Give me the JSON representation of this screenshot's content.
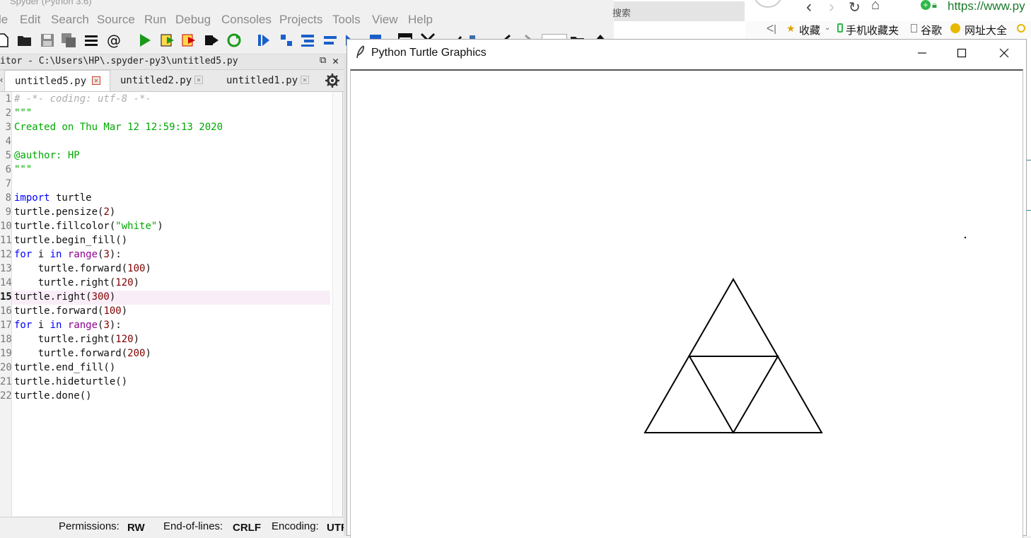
{
  "spyder": {
    "title_partial": "Spyder (Python 3.6)",
    "menu": [
      "le",
      "Edit",
      "Search",
      "Source",
      "Run",
      "Debug",
      "Consoles",
      "Projects",
      "Tools",
      "View",
      "Help"
    ],
    "editor_title": "itor - C:\\Users\\HP\\.spyder-py3\\untitled5.py",
    "tabs": [
      {
        "label": "untitled5.py",
        "active": true
      },
      {
        "label": "untitled2.py",
        "active": false
      },
      {
        "label": "untitled1.py",
        "active": false
      }
    ],
    "current_line": 15,
    "lines": [
      "# -*- coding: utf-8 -*-",
      "\"\"\"",
      "Created on Thu Mar 12 12:59:13 2020",
      "",
      "@author: HP",
      "\"\"\"",
      "",
      "import turtle",
      "turtle.pensize(2)",
      "turtle.fillcolor(\"white\")",
      "turtle.begin_fill()",
      "for i in range(3):",
      "    turtle.forward(100)",
      "    turtle.right(120)",
      "turtle.right(300)",
      "turtle.forward(100)",
      "for i in range(3):",
      "    turtle.right(120)",
      "    turtle.forward(200)",
      "turtle.end_fill()",
      "turtle.hideturtle()",
      "turtle.done()"
    ],
    "status": {
      "permissions_label": "Permissions:",
      "permissions_value": "RW",
      "eol_label": "End-of-lines:",
      "eol_value": "CRLF",
      "encoding_label": "Encoding:",
      "encoding_value": "UTF-"
    },
    "colors": {
      "keyword": "#0000ff",
      "string": "#00aa00",
      "comment": "#adadad",
      "number": "#800000",
      "builtin": "#900090"
    }
  },
  "browser": {
    "search_text": "搜索",
    "url": "https://www.py",
    "bookmarks": [
      "收藏",
      "手机收藏夹",
      "谷歌",
      "网址大全"
    ]
  },
  "turtle_window": {
    "title": "Python Turtle Graphics",
    "controls": [
      "minimize",
      "maximize",
      "close"
    ]
  }
}
